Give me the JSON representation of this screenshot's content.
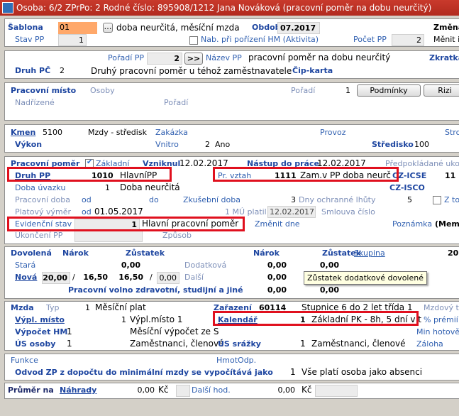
{
  "title": "Osoba: 6/2   ZPrPo: 2   Rodné číslo: 895908/1212   Jana Nováková   (pracovní poměr na dobu neurčitý)",
  "sablona": {
    "label": "Šablona",
    "code": "01",
    "text": "doba neurčitá, měsíční mzda",
    "obdobi_label": "Období",
    "obdobi": "07.2017",
    "zmena": "Změna"
  },
  "stav": {
    "label": "Stav PP",
    "value": "1",
    "nab_label": "Nab. při pořízení HM (Aktivita)",
    "pocet_label": "Počet PP",
    "pocet": "2",
    "menit": "Měnit i"
  },
  "poradi": {
    "label": "Pořadí PP",
    "value": "2",
    "btn": ">>",
    "nazev_label": "Název PP",
    "nazev": "pracovní poměr na dobu neurčitý",
    "zkratka": "Zkratka"
  },
  "druh_pc": {
    "label": "Druh PČ",
    "value": "2",
    "text": "Druhý pracovní poměr u téhož zaměstnavatele",
    "cip": "Čip-karta"
  },
  "misto": {
    "label": "Pracovní místo",
    "osoby": "Osoby",
    "poradi_label": "Pořadí",
    "poradi": "1",
    "btn1": "Podmínky",
    "btn2": "Rizi",
    "nadrizene": "Nadřízené",
    "poradi2": "Pořadí"
  },
  "kmen": {
    "label": "Kmen",
    "value": "5100",
    "text": "Mzdy - středisk",
    "zakazka": "Zakázka",
    "provoz": "Provoz",
    "stroj": "Stroj"
  },
  "vykon": {
    "label": "Výkon",
    "vnitro": "Vnitro",
    "vnitro_val": "2",
    "vnitro_text": "Ano",
    "stredisko": "Středisko",
    "stredisko_val": "100"
  },
  "pomer": {
    "label": "Pracovní poměr",
    "zakladni": "Základní",
    "vzniknul": "Vzniknul",
    "vzniknul_val": "12.02.2017",
    "nastup": "Nástup do práce",
    "nastup_val": "12.02.2017",
    "predp": "Předpokládané ukonč"
  },
  "druh_pp": {
    "label": "Druh PP",
    "value": "1010",
    "text": "HlavníPP",
    "vztah_label": "Pr. vztah",
    "vztah": "1111",
    "vztah_text": "Zam.v PP doba neurč",
    "czisce": "CZ-ICSE",
    "czisce_val": "11"
  },
  "doba": {
    "label": "Doba úvazku",
    "value": "1",
    "text": "Doba neurčitá",
    "czisco": "CZ-ISCO"
  },
  "prac_doba": {
    "label": "Pracovní doba",
    "od": "od",
    "do": "do",
    "zkus": "Zkušební doba",
    "zkus_val": "3",
    "dny": "Dny ochranné lhůty",
    "dny_val": "5",
    "ztoh": "Z toh"
  },
  "platovy": {
    "label": "Platový výměr",
    "od": "od",
    "od_val": "01.05.2017",
    "mu": "1 MÚ platil od",
    "mu_val": "12.02.2017",
    "smlouva": "Smlouva číslo"
  },
  "evid": {
    "label": "Evidenční stav",
    "value": "1",
    "text": "Hlavní pracovní poměr",
    "zmenit": "Změnit dne",
    "poznamka": "Poznámka",
    "memo": "(Memo"
  },
  "ukonceni": {
    "label": "Ukončení PP",
    "zpusob": "Způsob"
  },
  "dovolena": {
    "label": "Dovolená",
    "narok": "Nárok",
    "zustatek": "Zůstatek",
    "narok2": "Nárok",
    "zustatek2": "Zůstatek",
    "skupina": "Skupina",
    "skupina_val": "20",
    "stara": "Stará",
    "stara_val": "0,00",
    "dodatkova": "Dodatková",
    "dodatkova_n": "0,00",
    "dodatkova_z": "0,00",
    "nova": "Nová",
    "nova_a": "20,00",
    "nova_b": "16,50",
    "nova_c": "16,50",
    "nova_d": "0,00",
    "dalsi": "Další",
    "dalsi_n": "0,00",
    "volno": "Pracovní volno zdravotní, studijní a jiné",
    "volno_n": "0,00",
    "volno_z": "0,00",
    "tooltip": "Zůstatek dodatkové dovolené"
  },
  "mzda": {
    "label": "Mzda",
    "typ": "Typ",
    "typ_val": "1",
    "typ_text": "Měsíční plat",
    "zarazeni": "Zařazení",
    "zarazeni_val": "60114",
    "stupnice": "Stupnice 6 do 2 let třída 1",
    "mzdovy": "Mzdový tarif",
    "vypl": "Výpl. místo",
    "vypl_val": "1",
    "vypl_text": "Výpl.místo 1",
    "kal": "Kalendář",
    "kal_val": "1",
    "kal_text": "Základní PK - 8h, 5 dní v t",
    "premii": "% prémií",
    "vypocet": "Výpočet HM",
    "vypocet_val": "1",
    "vypocet_text": "Měsíční výpočet ze S",
    "min": "Min hotově",
    "us_osoby": "ÚS osoby",
    "us_val": "1",
    "us_text": "Zaměstnanci, členové",
    "us_srazky": "ÚS srážky",
    "us2_val": "1",
    "us2_text": "Zaměstnanci, členové",
    "zaloha": "Záloha"
  },
  "funkce": {
    "label": "Funkce",
    "hmot": "HmotOdp.",
    "odvod": "Odvod ZP z dopočtu do minimální mzdy se  vypočítává jako",
    "odvod_val": "1",
    "odvod_text": "Vše platí osoba jako absenci"
  },
  "prumer": {
    "label": "Průměr na",
    "nahrady": "Náhrady",
    "nahrady_val": "0,00",
    "kc": "Kč",
    "dalsi": "Další hod.",
    "dalsi_val": "0,00",
    "kc2": "Kč"
  }
}
